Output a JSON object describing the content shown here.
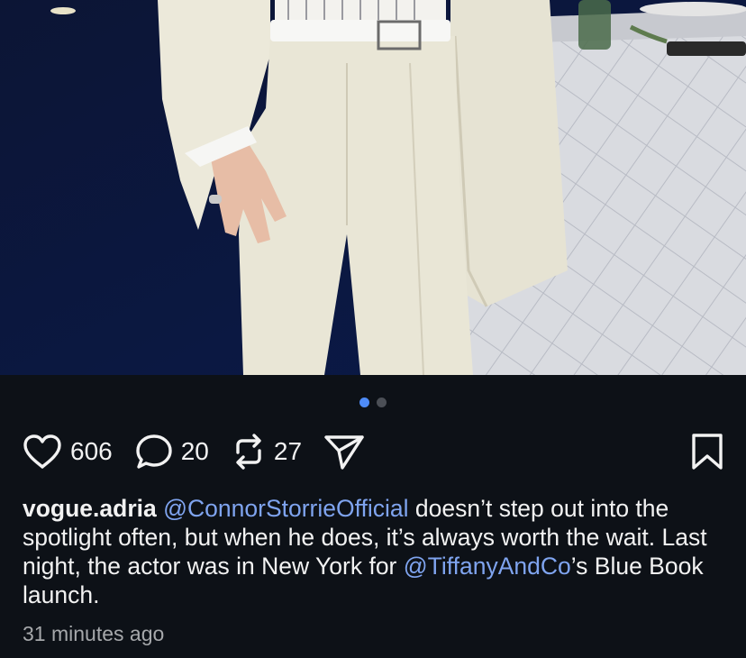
{
  "post": {
    "photo": {
      "description_hidden": true,
      "carousel": {
        "total": 2,
        "active_index": 1
      }
    },
    "actions": {
      "likes": "606",
      "comments": "20",
      "reposts": "27"
    },
    "caption": {
      "username": "vogue.adria",
      "mention1": "@ConnorStorrieOfficial",
      "text1": " doesn’t step out into the spotlight often, but when he does, it’s always worth the wait. Last night, the actor was in New York for ",
      "mention2": "@TiffanyAndCo",
      "text2": "’s Blue Book launch."
    },
    "timestamp": "31 minutes ago"
  },
  "icons": {
    "like": "heart-icon",
    "comment": "comment-bubble-icon",
    "repost": "repost-icon",
    "share": "send-icon",
    "save": "bookmark-icon"
  },
  "colors": {
    "background": "#0d1117",
    "mention": "#7fa4ef",
    "active_dot": "#4e8bf7",
    "inactive_dot": "#4b4f56",
    "timestamp": "#a6a8ab"
  }
}
